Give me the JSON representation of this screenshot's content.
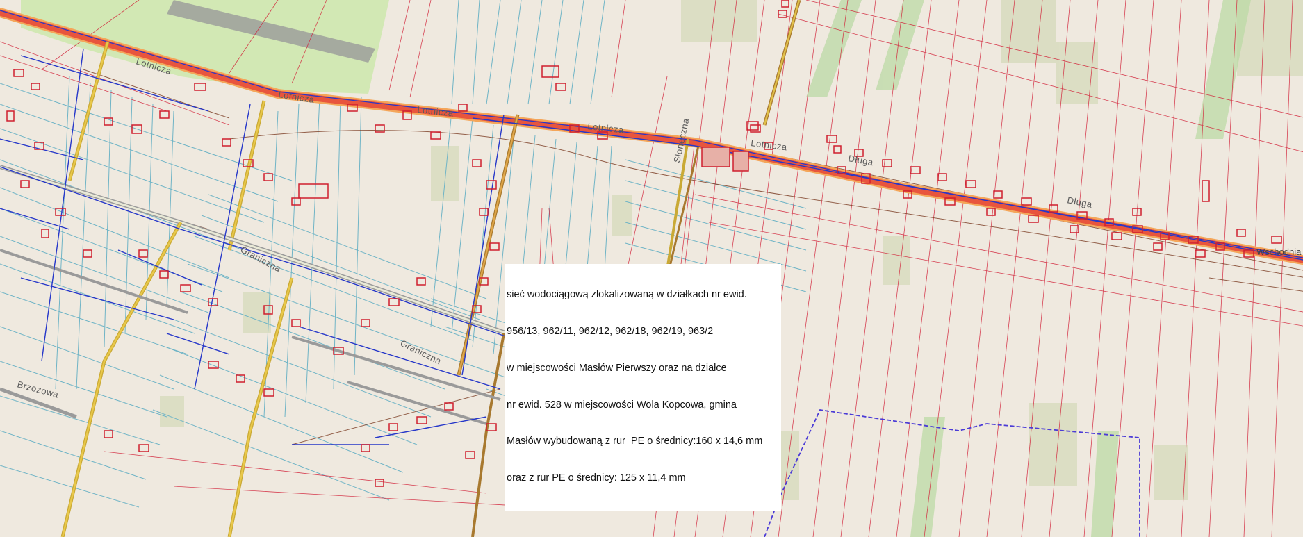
{
  "map": {
    "streets": {
      "lotnicza": "Lotnicza",
      "graniczna": "Graniczna",
      "brzozowa": "Brzozowa",
      "dluga": "Długa",
      "wschodnia": "Wschodnia",
      "sloneczna": "Słoneczna"
    },
    "annotation_lines": [
      "sieć wodociągową zlokalizowaną w działkach nr ewid.",
      "956/13, 962/11, 962/12, 962/18, 962/19, 963/2",
      "w miejscowości Masłów Pierwszy oraz na działce",
      "nr ewid. 528 w miejscowości Wola Kopcowa, gmina",
      "Masłów wybudowaną z rur  PE o średnicy:160 x 14,6 mm",
      "oraz z rur PE o średnicy: 125 x 11,4 mm"
    ],
    "colors": {
      "background": "#efe9df",
      "main_road": "#e8553d",
      "parcel_line_red": "#d2233a",
      "parcel_line_cyan": "#6fb4c6",
      "water_pipe_blue": "#2637c9",
      "new_pipe_highlight": "#1e90e0",
      "building": "#cf1f2e",
      "field_green": "#cfe5b4",
      "boundary_purple": "#4b3bd6"
    }
  }
}
